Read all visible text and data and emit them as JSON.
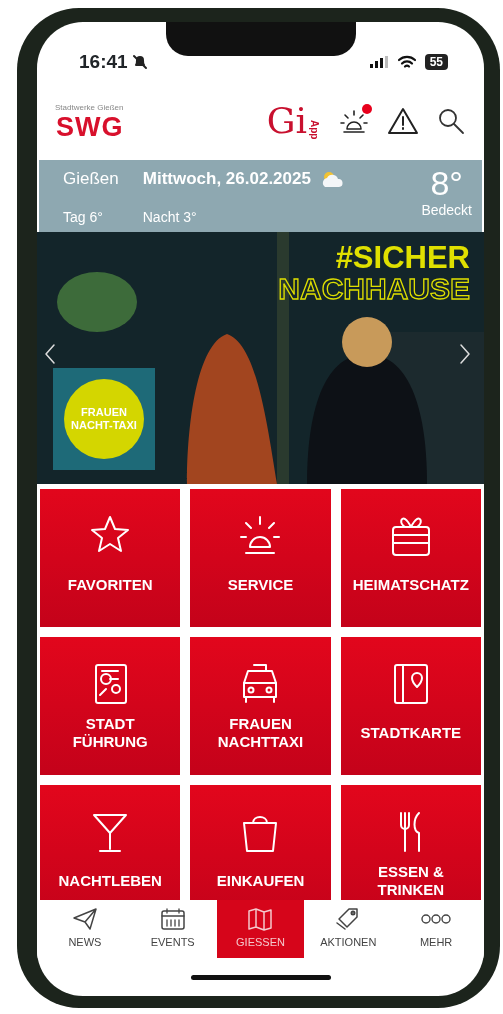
{
  "status_bar": {
    "time": "16:41",
    "battery": "55"
  },
  "header": {
    "logo_caption": "Stadtwerke Gießen",
    "logo": "SWG",
    "app_logo": "Gi",
    "app_logo_sub": "App",
    "alarm_badge": true
  },
  "weather": {
    "city": "Gießen",
    "date": "Mittwoch, 26.02.2025",
    "temperature": "8°",
    "day": "Tag 6°",
    "night": "Nacht 3°",
    "condition": "Bedeckt"
  },
  "banner": {
    "headline": "#SICHER",
    "subline": "NACHHAUSE",
    "badge_lines": [
      "FRAUEN",
      "NACHT-TAXI"
    ]
  },
  "tiles": [
    {
      "kind": "star",
      "lines": [
        "FAVORITEN"
      ]
    },
    {
      "kind": "alarm",
      "lines": [
        "SERVICE"
      ]
    },
    {
      "kind": "gift",
      "lines": [
        "HEIMATSCHATZ"
      ]
    },
    {
      "kind": "tour",
      "lines": [
        "STADT",
        "FÜHRUNG"
      ]
    },
    {
      "kind": "taxi",
      "lines": [
        "FRAUEN",
        "NACHTTAXI"
      ]
    },
    {
      "kind": "map",
      "lines": [
        "STADTKARTE"
      ]
    },
    {
      "kind": "glass",
      "lines": [
        "NACHTLEBEN"
      ]
    },
    {
      "kind": "bag",
      "lines": [
        "EINKAUFEN"
      ]
    },
    {
      "kind": "cutlery",
      "lines": [
        "ESSEN &",
        "TRINKEN"
      ]
    }
  ],
  "bottom_nav": [
    {
      "kind": "plane",
      "label": "NEWS",
      "selected": false
    },
    {
      "kind": "calendar",
      "label": "EVENTS",
      "selected": false
    },
    {
      "kind": "map",
      "label": "GIESSEN",
      "selected": true
    },
    {
      "kind": "tag",
      "label": "AKTIONEN",
      "selected": false
    },
    {
      "kind": "dots",
      "label": "MEHR",
      "selected": false
    }
  ]
}
